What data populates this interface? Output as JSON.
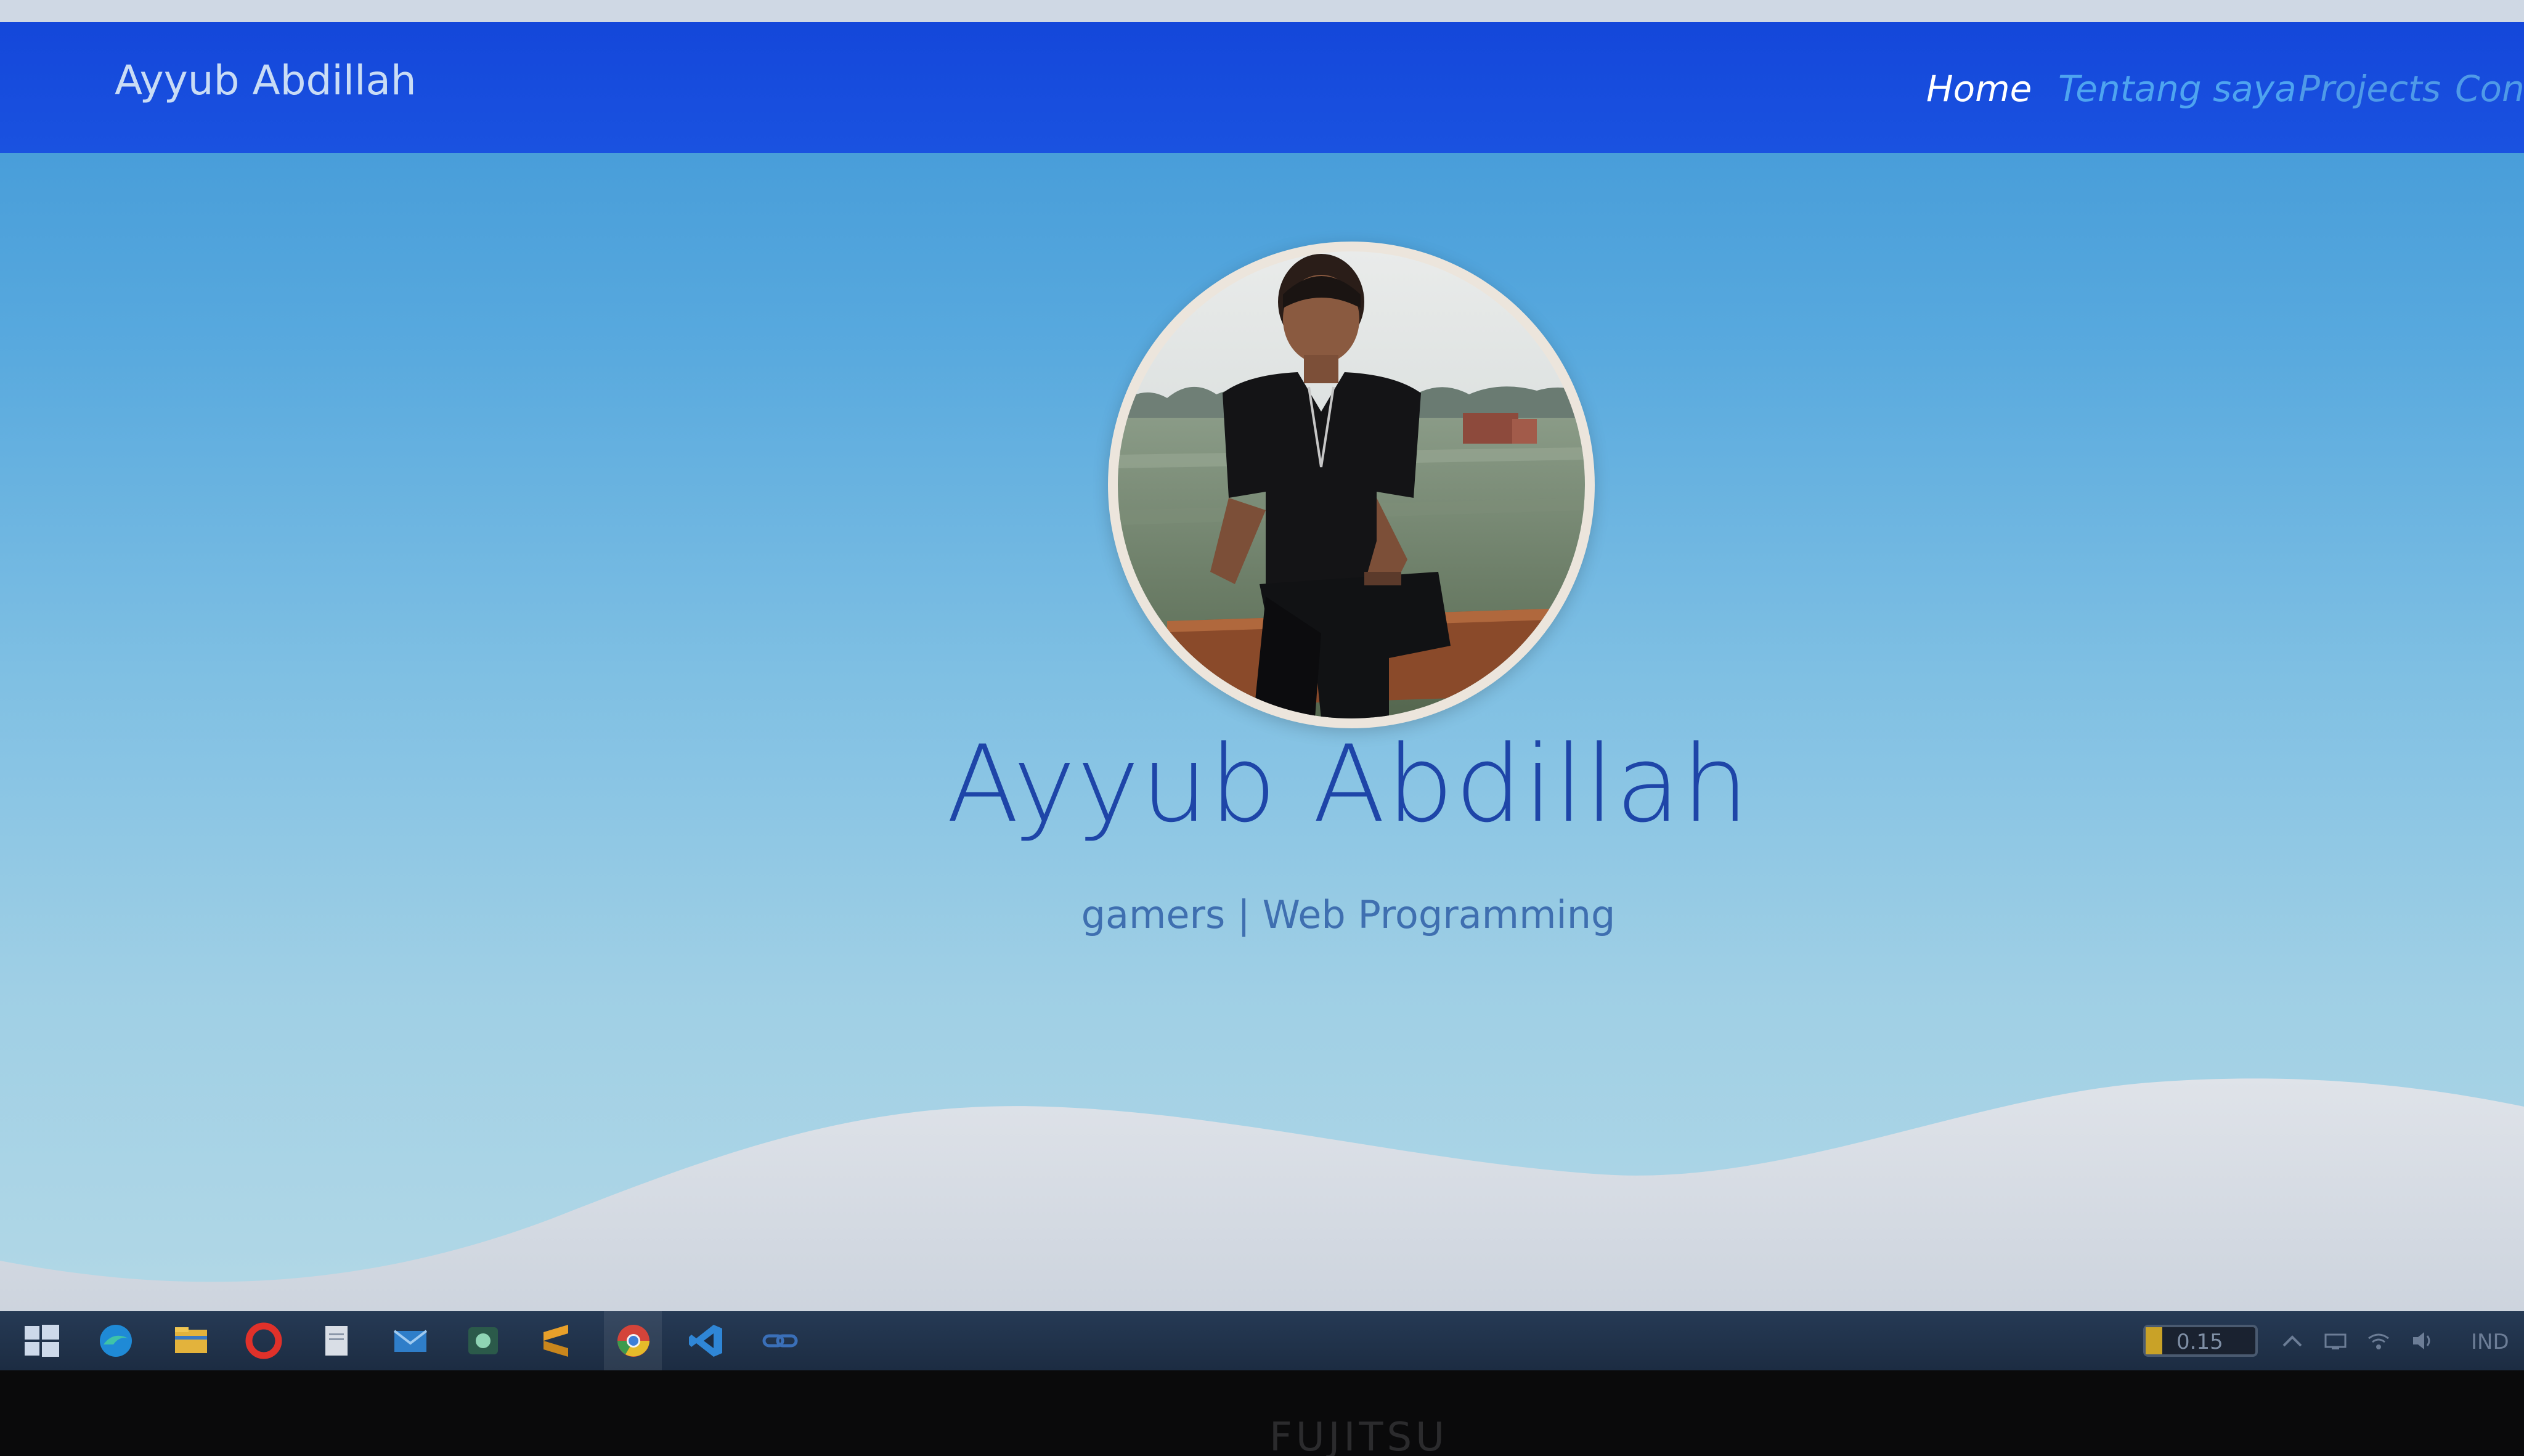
{
  "site": {
    "brand": "Ayyub Abdillah",
    "nav": [
      {
        "label": "Home",
        "active": true
      },
      {
        "label": "Tentang saya",
        "active": false
      },
      {
        "label": "Projects",
        "active": false
      },
      {
        "label": "Con",
        "active": false
      }
    ]
  },
  "hero": {
    "name": "Ayyub Abdillah",
    "tagline": "gamers | Web Programming",
    "avatar_icon": "profile-photo"
  },
  "taskbar": {
    "icons": [
      "windows-start-icon",
      "edge-icon",
      "file-explorer-icon",
      "opera-icon",
      "notepad-icon",
      "mail-icon",
      "terminal-icon",
      "sublime-text-icon",
      "chrome-icon",
      "vscode-icon",
      "link-icon"
    ],
    "battery_text": "0.15",
    "battery_level": 0.15,
    "language": "IND",
    "tray_icons": [
      "chevron-up-icon",
      "network-icon",
      "wifi-icon",
      "volume-icon"
    ]
  },
  "bezel": {
    "logo": "FUJITSU"
  },
  "colors": {
    "navbar": "#1447da",
    "nav_active": "#ffffff",
    "nav_inactive": "#4ea4f0",
    "hero_name": "#1e45a8",
    "tagline": "#3f6fb0",
    "wave": "#d8dde6"
  }
}
